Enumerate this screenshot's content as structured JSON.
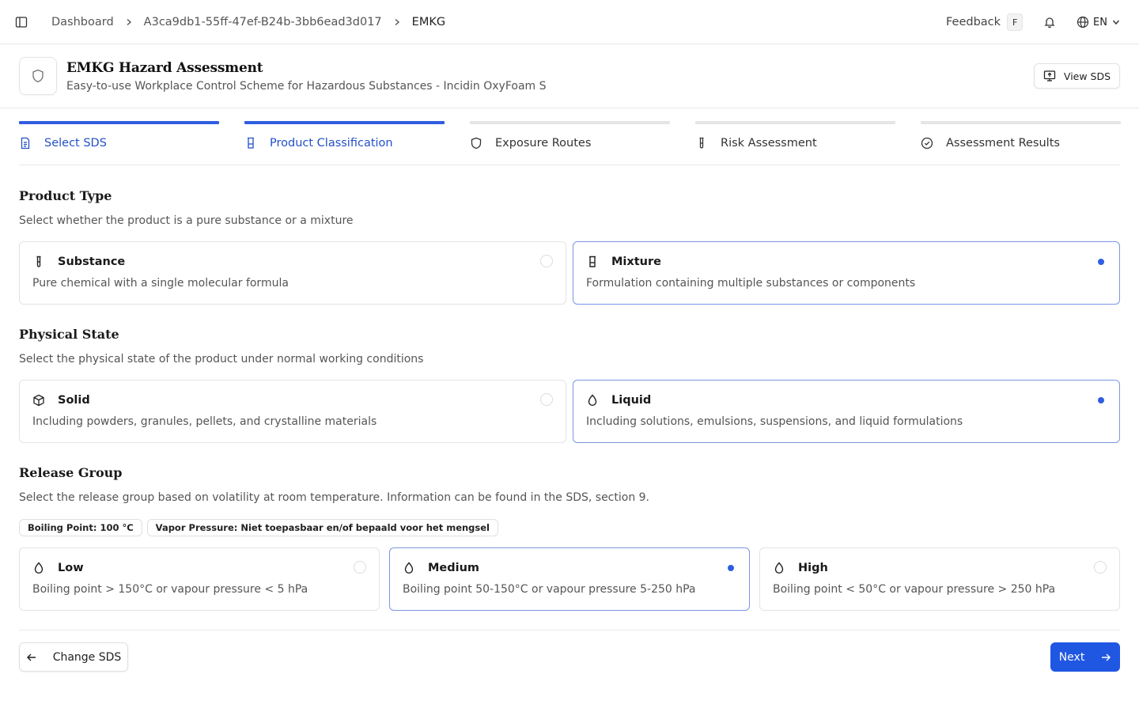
{
  "topbar": {
    "breadcrumbs": [
      "Dashboard",
      "A3ca9db1-55ff-47ef-B24b-3bb6ead3d017",
      "EMKG"
    ],
    "feedback_label": "Feedback",
    "feedback_shortcut": "F",
    "language": "EN"
  },
  "header": {
    "title": "EMKG Hazard Assessment",
    "subtitle": "Easy-to-use Workplace Control Scheme for Hazardous Substances - Incidin OxyFoam S",
    "view_sds_label": "View SDS"
  },
  "steps": [
    {
      "label": "Select SDS",
      "icon": "file-text-icon",
      "state": "complete"
    },
    {
      "label": "Product Classification",
      "icon": "beaker-icon",
      "state": "current"
    },
    {
      "label": "Exposure Routes",
      "icon": "shield-icon",
      "state": "pending"
    },
    {
      "label": "Risk Assessment",
      "icon": "test-tube-icon",
      "state": "pending"
    },
    {
      "label": "Assessment Results",
      "icon": "check-circle-icon",
      "state": "pending"
    }
  ],
  "product_type": {
    "title": "Product Type",
    "description": "Select whether the product is a pure substance or a mixture",
    "options": [
      {
        "title": "Substance",
        "description": "Pure chemical with a single molecular formula",
        "icon": "test-tube-icon",
        "selected": false
      },
      {
        "title": "Mixture",
        "description": "Formulation containing multiple substances or components",
        "icon": "beaker-icon",
        "selected": true
      }
    ]
  },
  "physical_state": {
    "title": "Physical State",
    "description": "Select the physical state of the product under normal working conditions",
    "options": [
      {
        "title": "Solid",
        "description": "Including powders, granules, pellets, and crystalline materials",
        "icon": "box-icon",
        "selected": false
      },
      {
        "title": "Liquid",
        "description": "Including solutions, emulsions, suspensions, and liquid formulations",
        "icon": "droplet-icon",
        "selected": true
      }
    ]
  },
  "release_group": {
    "title": "Release Group",
    "description": "Select the release group based on volatility at room temperature. Information can be found in the SDS, section 9.",
    "chips": [
      "Boiling Point: 100 °C",
      "Vapor Pressure: Niet toepasbaar en/of bepaald voor het mengsel"
    ],
    "options": [
      {
        "title": "Low",
        "description": "Boiling point > 150°C or vapour pressure < 5 hPa",
        "icon": "droplet-icon",
        "selected": false
      },
      {
        "title": "Medium",
        "description": "Boiling point 50-150°C or vapour pressure 5-250 hPa",
        "icon": "droplet-icon",
        "selected": true
      },
      {
        "title": "High",
        "description": "Boiling point < 50°C or vapour pressure > 250 hPa",
        "icon": "droplet-icon",
        "selected": false
      }
    ]
  },
  "footer": {
    "back_label": "Change SDS",
    "next_label": "Next"
  },
  "colors": {
    "accent": "#2057e2",
    "selected_border": "#7b97e3"
  }
}
